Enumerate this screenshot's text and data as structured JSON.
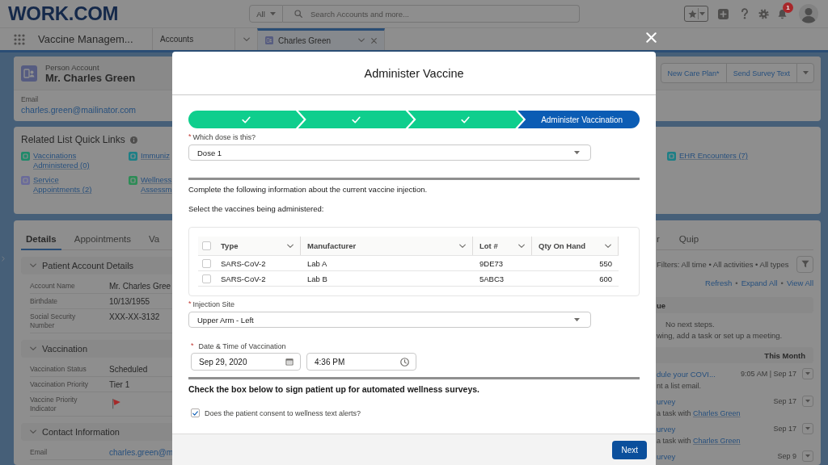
{
  "header": {
    "logo": "WORK.COM",
    "search": {
      "scope": "All",
      "placeholder": "Search Accounts and more..."
    },
    "notification_count": "1"
  },
  "nav": {
    "app_name": "Vaccine Managem...",
    "tabs": [
      {
        "kind": "object",
        "label": "Accounts",
        "selected": false
      },
      {
        "kind": "record",
        "label": "Charles Green",
        "selected": true
      }
    ]
  },
  "record": {
    "type_label": "Person Account",
    "name": "Mr. Charles Green",
    "actions": [
      "New Care Plan*",
      "Send Survey Text"
    ],
    "fields": [
      {
        "label": "Email",
        "value": "charles.green@mailinator.com"
      }
    ]
  },
  "quick_links": {
    "title": "Related List Quick Links",
    "links": [
      {
        "label": "Vaccinations Administered (0)",
        "color": "#1f8a6a"
      },
      {
        "label": "Immuniz",
        "color": "#1d7f86"
      },
      {
        "label": "EHR Encounters (7)",
        "color": "#1d7f86"
      },
      {
        "label": "Service Appointments (2)",
        "color": "#6a6b9a"
      },
      {
        "label": "Wellness Assessm",
        "color": "#2d8c56"
      }
    ]
  },
  "details": {
    "tabs": [
      {
        "label": "Details",
        "selected": true
      },
      {
        "label": "Appointments",
        "selected": false
      },
      {
        "label": "Va",
        "selected": false
      }
    ],
    "sections": [
      {
        "title": "Patient Account Details",
        "expanded": true,
        "fields": [
          {
            "kind": "text",
            "label": "Account Name",
            "value": "Mr. Charles Gree"
          },
          {
            "kind": "text",
            "label": "Birthdate",
            "value": "10/13/1955"
          },
          {
            "kind": "text",
            "label": "Social Security Number",
            "value": "XXX-XX-3132"
          }
        ]
      },
      {
        "title": "Vaccination",
        "expanded": true,
        "fields": [
          {
            "kind": "text",
            "label": "Vaccination Status",
            "value": "Scheduled"
          },
          {
            "kind": "text",
            "label": "Vaccination Priority",
            "value": "Tier 1"
          },
          {
            "kind": "flag",
            "label": "Vaccine Priority Indicator"
          }
        ]
      },
      {
        "title": "Contact Information",
        "expanded": true,
        "fields": [
          {
            "kind": "link",
            "label": "Email",
            "value": "charles.green@m"
          }
        ]
      }
    ]
  },
  "activity": {
    "tabs": [
      {
        "label": "r",
        "selected": false
      },
      {
        "label": "Quip",
        "selected": false
      }
    ],
    "filters": "Filters: All time • All activities • All types",
    "links": [
      {
        "kind": "link",
        "text": "Refresh"
      },
      {
        "kind": "separator",
        "text": "•"
      },
      {
        "kind": "link",
        "text": "Expand All"
      },
      {
        "kind": "separator",
        "text": "•"
      },
      {
        "kind": "link",
        "text": "View All"
      }
    ],
    "upcoming": {
      "heading": "ue",
      "lines": [
        "No next steps.",
        "wing, add a task or set up a meeting."
      ]
    },
    "month": {
      "heading": "This Month",
      "items": [
        {
          "title": "dule your COVI...",
          "time": "9:05 AM | Sep 17",
          "description": "nt a list email."
        },
        {
          "title": "urvey",
          "time": "Sep 17",
          "description": "a task with",
          "link": "Charles Green"
        },
        {
          "title": "urvey",
          "time": "Sep 17",
          "description": "a task with",
          "link": "Charles Green"
        },
        {
          "title": "urvey",
          "time": "Sep 9"
        }
      ]
    }
  },
  "modal": {
    "title": "Administer Vaccine",
    "path": [
      {
        "completed": true,
        "selected": false
      },
      {
        "completed": true,
        "selected": false
      },
      {
        "completed": true,
        "selected": false
      },
      {
        "completed": false,
        "selected": true,
        "label": "Administer Vaccination"
      }
    ],
    "dose": {
      "required_mark": "*",
      "label": "Which dose is this?",
      "value": "Dose 1"
    },
    "intro": "Complete the following information about the current vaccine injection.",
    "table_prompt": "Select the vaccines being administered:",
    "table": {
      "columns": [
        "Type",
        "Manufacturer",
        "Lot #",
        "Qty On Hand"
      ],
      "all_checked": false,
      "rows": [
        {
          "checked": false,
          "cells": [
            "SARS-CoV-2",
            "Lab A",
            "9DE73",
            "550"
          ]
        },
        {
          "checked": false,
          "cells": [
            "SARS-CoV-2",
            "Lab B",
            "5ABC3",
            "600"
          ]
        }
      ]
    },
    "injection_site": {
      "required_mark": "*",
      "label": "Injection Site",
      "value": "Upper Arm - Left"
    },
    "date_time": {
      "required_mark": "*",
      "label": "Date & Time of Vaccination",
      "date": "Sep 29, 2020",
      "time": "4:36 PM"
    },
    "survey_prompt": "Check the box below to sign patient up for automated wellness surveys.",
    "consent": {
      "label": "Does the patient consent to wellness text alerts?",
      "checked": true
    },
    "buttons": [
      "Next"
    ]
  }
}
